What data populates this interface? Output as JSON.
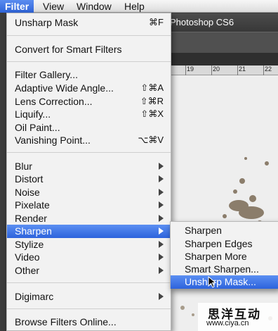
{
  "menubar": {
    "items": [
      {
        "label": "Filter",
        "active": true
      },
      {
        "label": "View"
      },
      {
        "label": "Window"
      },
      {
        "label": "Help"
      }
    ]
  },
  "app": {
    "title": "Photoshop CS6",
    "ruler_ticks": [
      "19",
      "20",
      "21",
      "22"
    ]
  },
  "filter_menu": {
    "items": [
      {
        "label": "Unsharp Mask",
        "shortcut": "⌘F"
      },
      {
        "label": "Convert for Smart Filters"
      },
      {
        "label": "Filter Gallery..."
      },
      {
        "label": "Adaptive Wide Angle...",
        "shortcut": "⇧⌘A"
      },
      {
        "label": "Lens Correction...",
        "shortcut": "⇧⌘R"
      },
      {
        "label": "Liquify...",
        "shortcut": "⇧⌘X"
      },
      {
        "label": "Oil Paint..."
      },
      {
        "label": "Vanishing Point...",
        "shortcut": "⌥⌘V"
      },
      {
        "label": "Blur"
      },
      {
        "label": "Distort"
      },
      {
        "label": "Noise"
      },
      {
        "label": "Pixelate"
      },
      {
        "label": "Render"
      },
      {
        "label": "Sharpen",
        "highlighted": true
      },
      {
        "label": "Stylize"
      },
      {
        "label": "Video"
      },
      {
        "label": "Other"
      },
      {
        "label": "Digimarc"
      },
      {
        "label": "Browse Filters Online..."
      }
    ]
  },
  "sharpen_submenu": {
    "items": [
      {
        "label": "Sharpen"
      },
      {
        "label": "Sharpen Edges"
      },
      {
        "label": "Sharpen More"
      },
      {
        "label": "Smart Sharpen..."
      },
      {
        "label": "Unsharp Mask...",
        "highlighted": true
      }
    ]
  },
  "watermark": {
    "line1": "思洋互动",
    "line2": "www.ciya.cn"
  },
  "colors": {
    "highlight": "#2d63dc",
    "menu_bg": "#f2f2f2"
  }
}
